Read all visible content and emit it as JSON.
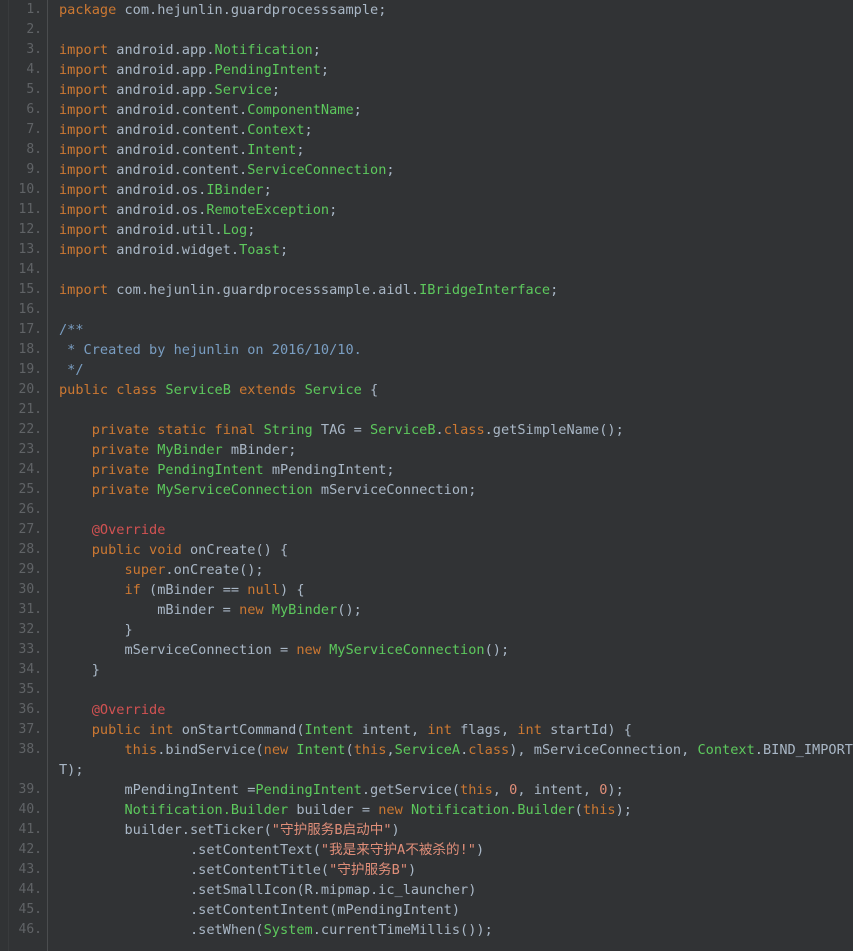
{
  "editor": {
    "language": "java",
    "theme": "darcula",
    "background_color": "#313335",
    "gutter_color": "#313335",
    "line_number_color": "#606366",
    "default_text_color": "#a9b7c6",
    "font_size_px": 13.6,
    "line_height_px": 20,
    "total_visible_lines": 46,
    "colors": {
      "keyword": "#cc7832",
      "class_name": "#5dc95d",
      "type_name": "#6a8759",
      "string": "#e08e79",
      "number": "#e08e79",
      "annotation": "#d25252",
      "doc_comment": "#7a9ec2",
      "plain": "#a9b7c6"
    }
  },
  "code_lines": [
    {
      "n": "1.",
      "tokens": [
        {
          "t": "kw",
          "s": "package"
        },
        {
          "t": "pln",
          "s": " com.hejunlin.guardprocesssample;"
        }
      ]
    },
    {
      "n": "2.",
      "tokens": []
    },
    {
      "n": "3.",
      "tokens": [
        {
          "t": "kw",
          "s": "import"
        },
        {
          "t": "pln",
          "s": " android.app."
        },
        {
          "t": "cls",
          "s": "Notification"
        },
        {
          "t": "pln",
          "s": ";"
        }
      ]
    },
    {
      "n": "4.",
      "tokens": [
        {
          "t": "kw",
          "s": "import"
        },
        {
          "t": "pln",
          "s": " android.app."
        },
        {
          "t": "cls",
          "s": "PendingIntent"
        },
        {
          "t": "pln",
          "s": ";"
        }
      ]
    },
    {
      "n": "5.",
      "tokens": [
        {
          "t": "kw",
          "s": "import"
        },
        {
          "t": "pln",
          "s": " android.app."
        },
        {
          "t": "cls",
          "s": "Service"
        },
        {
          "t": "pln",
          "s": ";"
        }
      ]
    },
    {
      "n": "6.",
      "tokens": [
        {
          "t": "kw",
          "s": "import"
        },
        {
          "t": "pln",
          "s": " android.content."
        },
        {
          "t": "cls",
          "s": "ComponentName"
        },
        {
          "t": "pln",
          "s": ";"
        }
      ]
    },
    {
      "n": "7.",
      "tokens": [
        {
          "t": "kw",
          "s": "import"
        },
        {
          "t": "pln",
          "s": " android.content."
        },
        {
          "t": "cls",
          "s": "Context"
        },
        {
          "t": "pln",
          "s": ";"
        }
      ]
    },
    {
      "n": "8.",
      "tokens": [
        {
          "t": "kw",
          "s": "import"
        },
        {
          "t": "pln",
          "s": " android.content."
        },
        {
          "t": "cls",
          "s": "Intent"
        },
        {
          "t": "pln",
          "s": ";"
        }
      ]
    },
    {
      "n": "9.",
      "tokens": [
        {
          "t": "kw",
          "s": "import"
        },
        {
          "t": "pln",
          "s": " android.content."
        },
        {
          "t": "cls",
          "s": "ServiceConnection"
        },
        {
          "t": "pln",
          "s": ";"
        }
      ]
    },
    {
      "n": "10.",
      "tokens": [
        {
          "t": "kw",
          "s": "import"
        },
        {
          "t": "pln",
          "s": " android.os."
        },
        {
          "t": "cls",
          "s": "IBinder"
        },
        {
          "t": "pln",
          "s": ";"
        }
      ]
    },
    {
      "n": "11.",
      "tokens": [
        {
          "t": "kw",
          "s": "import"
        },
        {
          "t": "pln",
          "s": " android.os."
        },
        {
          "t": "cls",
          "s": "RemoteException"
        },
        {
          "t": "pln",
          "s": ";"
        }
      ]
    },
    {
      "n": "12.",
      "tokens": [
        {
          "t": "kw",
          "s": "import"
        },
        {
          "t": "pln",
          "s": " android.util."
        },
        {
          "t": "cls",
          "s": "Log"
        },
        {
          "t": "pln",
          "s": ";"
        }
      ]
    },
    {
      "n": "13.",
      "tokens": [
        {
          "t": "kw",
          "s": "import"
        },
        {
          "t": "pln",
          "s": " android.widget."
        },
        {
          "t": "cls",
          "s": "Toast"
        },
        {
          "t": "pln",
          "s": ";"
        }
      ]
    },
    {
      "n": "14.",
      "tokens": []
    },
    {
      "n": "15.",
      "tokens": [
        {
          "t": "kw",
          "s": "import"
        },
        {
          "t": "pln",
          "s": " com.hejunlin.guardprocesssample.aidl."
        },
        {
          "t": "cls",
          "s": "IBridgeInterface"
        },
        {
          "t": "pln",
          "s": ";"
        }
      ]
    },
    {
      "n": "16.",
      "tokens": []
    },
    {
      "n": "17.",
      "tokens": [
        {
          "t": "doc",
          "s": "/**"
        }
      ]
    },
    {
      "n": "18.",
      "tokens": [
        {
          "t": "doc",
          "s": " * Created by hejunlin on 2016/10/10."
        }
      ]
    },
    {
      "n": "19.",
      "tokens": [
        {
          "t": "doc",
          "s": " */"
        }
      ]
    },
    {
      "n": "20.",
      "tokens": [
        {
          "t": "kw",
          "s": "public class"
        },
        {
          "t": "pln",
          "s": " "
        },
        {
          "t": "cls",
          "s": "ServiceB"
        },
        {
          "t": "pln",
          "s": " "
        },
        {
          "t": "kw",
          "s": "extends"
        },
        {
          "t": "pln",
          "s": " "
        },
        {
          "t": "cls",
          "s": "Service"
        },
        {
          "t": "pln",
          "s": " {"
        }
      ]
    },
    {
      "n": "21.",
      "tokens": []
    },
    {
      "n": "22.",
      "tokens": [
        {
          "t": "pln",
          "s": "    "
        },
        {
          "t": "kw",
          "s": "private static final"
        },
        {
          "t": "pln",
          "s": " "
        },
        {
          "t": "cls",
          "s": "String"
        },
        {
          "t": "pln",
          "s": " TAG = "
        },
        {
          "t": "cls",
          "s": "ServiceB"
        },
        {
          "t": "pln",
          "s": "."
        },
        {
          "t": "kw",
          "s": "class"
        },
        {
          "t": "pln",
          "s": ".getSimpleName();"
        }
      ]
    },
    {
      "n": "23.",
      "tokens": [
        {
          "t": "pln",
          "s": "    "
        },
        {
          "t": "kw",
          "s": "private"
        },
        {
          "t": "pln",
          "s": " "
        },
        {
          "t": "cls",
          "s": "MyBinder"
        },
        {
          "t": "pln",
          "s": " mBinder;"
        }
      ]
    },
    {
      "n": "24.",
      "tokens": [
        {
          "t": "pln",
          "s": "    "
        },
        {
          "t": "kw",
          "s": "private"
        },
        {
          "t": "pln",
          "s": " "
        },
        {
          "t": "cls",
          "s": "PendingIntent"
        },
        {
          "t": "pln",
          "s": " mPendingIntent;"
        }
      ]
    },
    {
      "n": "25.",
      "tokens": [
        {
          "t": "pln",
          "s": "    "
        },
        {
          "t": "kw",
          "s": "private"
        },
        {
          "t": "pln",
          "s": " "
        },
        {
          "t": "cls",
          "s": "MyServiceConnection"
        },
        {
          "t": "pln",
          "s": " mServiceConnection;"
        }
      ]
    },
    {
      "n": "26.",
      "tokens": []
    },
    {
      "n": "27.",
      "tokens": [
        {
          "t": "pln",
          "s": "    "
        },
        {
          "t": "anno",
          "s": "@Override"
        }
      ]
    },
    {
      "n": "28.",
      "tokens": [
        {
          "t": "pln",
          "s": "    "
        },
        {
          "t": "kw",
          "s": "public void"
        },
        {
          "t": "pln",
          "s": " onCreate() {"
        }
      ]
    },
    {
      "n": "29.",
      "tokens": [
        {
          "t": "pln",
          "s": "        "
        },
        {
          "t": "kw",
          "s": "super"
        },
        {
          "t": "pln",
          "s": ".onCreate();"
        }
      ]
    },
    {
      "n": "30.",
      "tokens": [
        {
          "t": "pln",
          "s": "        "
        },
        {
          "t": "kw",
          "s": "if"
        },
        {
          "t": "pln",
          "s": " (mBinder == "
        },
        {
          "t": "kw",
          "s": "null"
        },
        {
          "t": "pln",
          "s": ") {"
        }
      ]
    },
    {
      "n": "31.",
      "tokens": [
        {
          "t": "pln",
          "s": "            mBinder = "
        },
        {
          "t": "kw",
          "s": "new"
        },
        {
          "t": "pln",
          "s": " "
        },
        {
          "t": "cls",
          "s": "MyBinder"
        },
        {
          "t": "pln",
          "s": "();"
        }
      ]
    },
    {
      "n": "32.",
      "tokens": [
        {
          "t": "pln",
          "s": "        }"
        }
      ]
    },
    {
      "n": "33.",
      "tokens": [
        {
          "t": "pln",
          "s": "        mServiceConnection = "
        },
        {
          "t": "kw",
          "s": "new"
        },
        {
          "t": "pln",
          "s": " "
        },
        {
          "t": "cls",
          "s": "MyServiceConnection"
        },
        {
          "t": "pln",
          "s": "();"
        }
      ]
    },
    {
      "n": "34.",
      "tokens": [
        {
          "t": "pln",
          "s": "    }"
        }
      ]
    },
    {
      "n": "35.",
      "tokens": []
    },
    {
      "n": "36.",
      "tokens": [
        {
          "t": "pln",
          "s": "    "
        },
        {
          "t": "anno",
          "s": "@Override"
        }
      ]
    },
    {
      "n": "37.",
      "tokens": [
        {
          "t": "pln",
          "s": "    "
        },
        {
          "t": "kw",
          "s": "public int"
        },
        {
          "t": "pln",
          "s": " onStartCommand("
        },
        {
          "t": "cls",
          "s": "Intent"
        },
        {
          "t": "pln",
          "s": " intent, "
        },
        {
          "t": "kw",
          "s": "int"
        },
        {
          "t": "pln",
          "s": " flags, "
        },
        {
          "t": "kw",
          "s": "int"
        },
        {
          "t": "pln",
          "s": " startId) {"
        }
      ]
    },
    {
      "n": "38.",
      "tokens": [
        {
          "t": "pln",
          "s": "        "
        },
        {
          "t": "kw",
          "s": "this"
        },
        {
          "t": "pln",
          "s": ".bindService("
        },
        {
          "t": "kw",
          "s": "new"
        },
        {
          "t": "pln",
          "s": " "
        },
        {
          "t": "cls",
          "s": "Intent"
        },
        {
          "t": "pln",
          "s": "("
        },
        {
          "t": "kw",
          "s": "this"
        },
        {
          "t": "pln",
          "s": ","
        },
        {
          "t": "cls",
          "s": "ServiceA"
        },
        {
          "t": "pln",
          "s": "."
        },
        {
          "t": "kw",
          "s": "class"
        },
        {
          "t": "pln",
          "s": "), mServiceConnection, "
        },
        {
          "t": "cls",
          "s": "Context"
        },
        {
          "t": "pln",
          "s": ".BIND_IMPORTAN"
        }
      ],
      "wrapped": [
        {
          "t": "pln",
          "s": "T);"
        }
      ]
    },
    {
      "n": "39.",
      "tokens": [
        {
          "t": "pln",
          "s": "        mPendingIntent ="
        },
        {
          "t": "cls",
          "s": "PendingIntent"
        },
        {
          "t": "pln",
          "s": ".getService("
        },
        {
          "t": "kw",
          "s": "this"
        },
        {
          "t": "pln",
          "s": ", "
        },
        {
          "t": "num",
          "s": "0"
        },
        {
          "t": "pln",
          "s": ", intent, "
        },
        {
          "t": "num",
          "s": "0"
        },
        {
          "t": "pln",
          "s": ");"
        }
      ]
    },
    {
      "n": "40.",
      "tokens": [
        {
          "t": "pln",
          "s": "        "
        },
        {
          "t": "cls",
          "s": "Notification.Builder"
        },
        {
          "t": "pln",
          "s": " builder = "
        },
        {
          "t": "kw",
          "s": "new"
        },
        {
          "t": "pln",
          "s": " "
        },
        {
          "t": "cls",
          "s": "Notification.Builder"
        },
        {
          "t": "pln",
          "s": "("
        },
        {
          "t": "kw",
          "s": "this"
        },
        {
          "t": "pln",
          "s": ");"
        }
      ]
    },
    {
      "n": "41.",
      "tokens": [
        {
          "t": "pln",
          "s": "        builder.setTicker("
        },
        {
          "t": "str",
          "s": "\"守护服务B启动中\""
        },
        {
          "t": "pln",
          "s": ")"
        }
      ]
    },
    {
      "n": "42.",
      "tokens": [
        {
          "t": "pln",
          "s": "                .setContentText("
        },
        {
          "t": "str",
          "s": "\"我是来守护A不被杀的!\""
        },
        {
          "t": "pln",
          "s": ")"
        }
      ]
    },
    {
      "n": "43.",
      "tokens": [
        {
          "t": "pln",
          "s": "                .setContentTitle("
        },
        {
          "t": "str",
          "s": "\"守护服务B\""
        },
        {
          "t": "pln",
          "s": ")"
        }
      ]
    },
    {
      "n": "44.",
      "tokens": [
        {
          "t": "pln",
          "s": "                .setSmallIcon(R.mipmap.ic_launcher)"
        }
      ]
    },
    {
      "n": "45.",
      "tokens": [
        {
          "t": "pln",
          "s": "                .setContentIntent(mPendingIntent)"
        }
      ]
    },
    {
      "n": "46.",
      "tokens": [
        {
          "t": "pln",
          "s": "                .setWhen("
        },
        {
          "t": "cls",
          "s": "System"
        },
        {
          "t": "pln",
          "s": ".currentTimeMillis());"
        }
      ]
    }
  ]
}
